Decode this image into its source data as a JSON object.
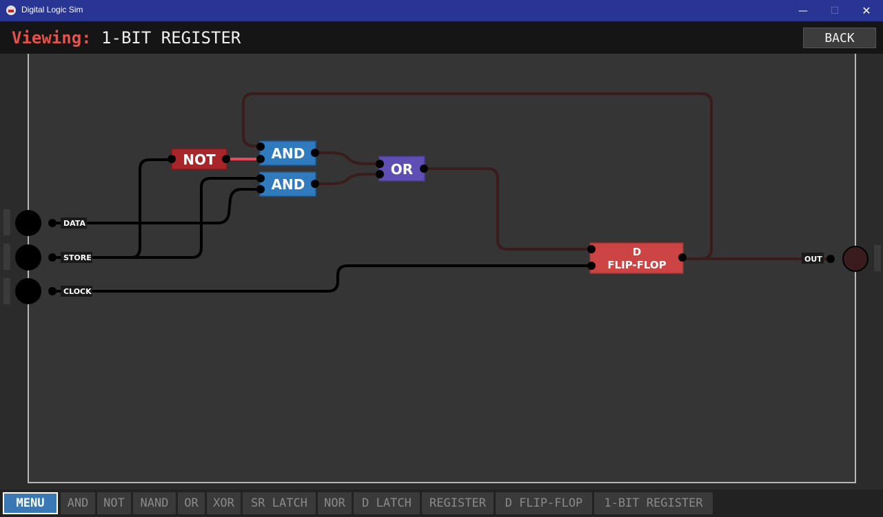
{
  "window": {
    "title": "Digital Logic Sim",
    "minimize_glyph": "—",
    "maximize_glyph": "☐",
    "close_glyph": "✕"
  },
  "header": {
    "viewing_label": "Viewing:",
    "chip_name": "1-BIT REGISTER",
    "back_label": "BACK"
  },
  "circuit": {
    "inputs": [
      "DATA",
      "STORE",
      "CLOCK"
    ],
    "outputs": [
      "OUT"
    ],
    "gates": {
      "not": "NOT",
      "and1": "AND",
      "and2": "AND",
      "or": "OR",
      "dff_line1": "D",
      "dff_line2": "FLIP-FLOP"
    },
    "colors": {
      "not_gate": "#a8262a",
      "and_gate": "#2f7bbd",
      "or_gate": "#5f4eb4",
      "dff_gate": "#cd4444",
      "wire_off": "#000000",
      "wire_dark_red": "#3a1c1c",
      "wire_on": "#e84a5a"
    }
  },
  "bottom_bar": {
    "menu": "MENU",
    "tabs": [
      "AND",
      "NOT",
      "NAND",
      "OR",
      "XOR",
      "SR LATCH",
      "NOR",
      "D LATCH",
      "REGISTER",
      "D FLIP-FLOP",
      "1-BIT REGISTER"
    ]
  }
}
